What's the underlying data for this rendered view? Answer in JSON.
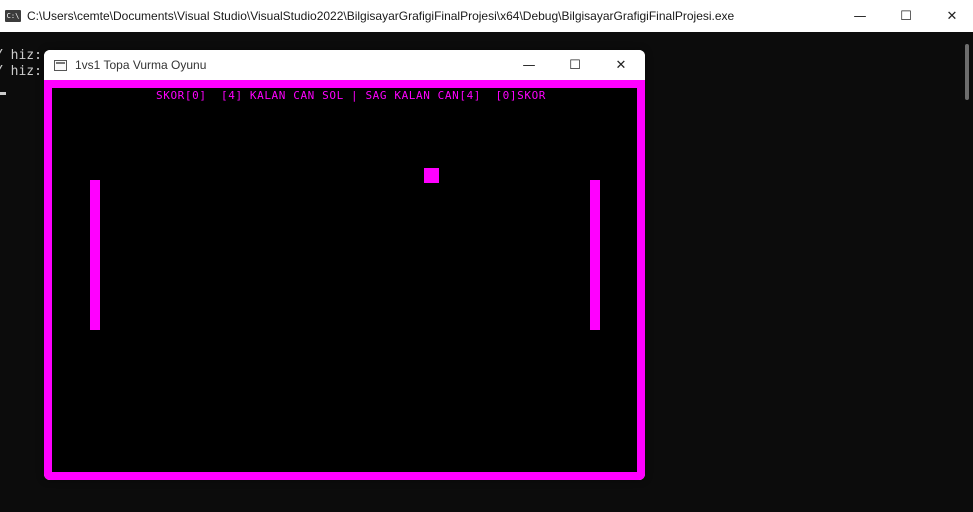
{
  "console": {
    "title": "C:\\Users\\cemte\\Documents\\Visual Studio\\VisualStudio2022\\BilgisayarGrafigiFinalProjesi\\x64\\Debug\\BilgisayarGrafigiFinalProjesi.exe",
    "icon": "console-icon",
    "icon_text": "C:\\",
    "lines": [
      "Y hiz:",
      "Y hiz:"
    ],
    "minimize_glyph": "—",
    "maximize_glyph": "☐",
    "close_glyph": "✕"
  },
  "game": {
    "title": "1vs1 Topa Vurma Oyunu",
    "minimize_glyph": "—",
    "maximize_glyph": "☐",
    "close_glyph": "✕",
    "score_text": "SKOR[0]  [4] KALAN CAN SOL | SAG KALAN CAN[4]  [0]SKOR",
    "colors": {
      "accent": "#ff00ff",
      "field": "#000000"
    }
  }
}
